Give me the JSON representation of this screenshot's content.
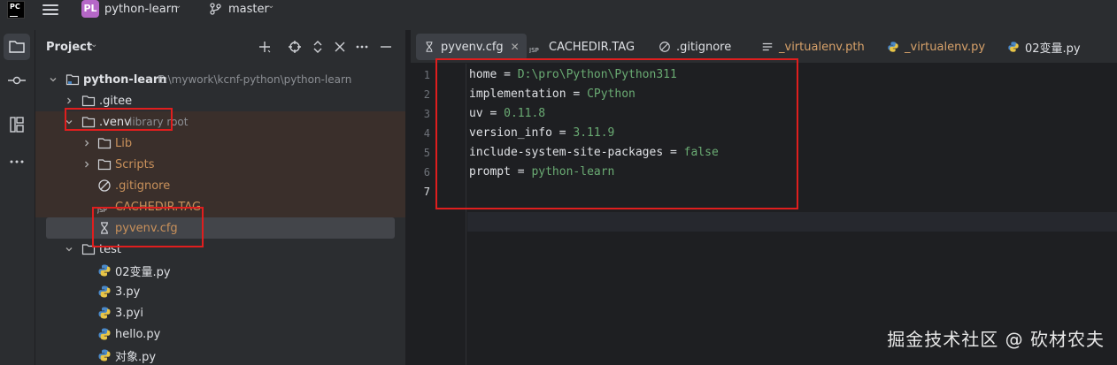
{
  "topbar": {
    "app_logo": "PC",
    "project_badge": "PL",
    "project_name": "python-learn",
    "branch": "master",
    "chevron": "⌄"
  },
  "project_panel": {
    "title": "Project",
    "header_icons": [
      "add-icon",
      "locate-icon",
      "expand-icon",
      "collapse-icon",
      "minimize-icon"
    ]
  },
  "tree": [
    {
      "label": "python-learn",
      "secondary": "E:\\mywork\\kcnf-python\\python-learn",
      "type": "folder",
      "bold": true
    },
    {
      "label": ".gitee",
      "type": "folder"
    },
    {
      "label": ".venv",
      "secondary": "library root",
      "type": "folder"
    },
    {
      "label": "Lib",
      "type": "folder"
    },
    {
      "label": "Scripts",
      "type": "folder"
    },
    {
      "label": ".gitignore",
      "type": "ignore-file"
    },
    {
      "label": "CACHEDIR.TAG",
      "type": "jsp-file"
    },
    {
      "label": "pyvenv.cfg",
      "type": "cfg-file",
      "selected": true
    },
    {
      "label": "test",
      "type": "folder"
    },
    {
      "label": "02变量.py",
      "type": "python-file"
    },
    {
      "label": "3.py",
      "type": "python-file"
    },
    {
      "label": "3.pyi",
      "type": "python-file"
    },
    {
      "label": "hello.py",
      "type": "python-file"
    },
    {
      "label": "对象.py",
      "type": "python-file"
    }
  ],
  "tabs": [
    {
      "label": "pyvenv.cfg",
      "active": true
    },
    {
      "label": "CACHEDIR.TAG"
    },
    {
      "label": ".gitignore"
    },
    {
      "label": "_virtualenv.pth"
    },
    {
      "label": "_virtualenv.py"
    },
    {
      "label": "02变量.py"
    }
  ],
  "tab_close": "✕",
  "code_lines": [
    {
      "n": "1",
      "key": "home = ",
      "val": "D:\\pro\\Python\\Python311"
    },
    {
      "n": "2",
      "key": "implementation = ",
      "val": "CPython"
    },
    {
      "n": "3",
      "key": "uv = ",
      "val": "0.11.8"
    },
    {
      "n": "4",
      "key": "version_info = ",
      "val": "3.11.9"
    },
    {
      "n": "5",
      "key": "include-system-site-packages = ",
      "val": "false"
    },
    {
      "n": "6",
      "key": "prompt = ",
      "val": "python-learn"
    },
    {
      "n": "7",
      "key": "",
      "val": ""
    }
  ],
  "watermark": "掘金技术社区 @ 砍材农夫",
  "colors": {
    "accent_red": "#e01e1e",
    "value_green": "#6aab73",
    "ignored_orange": "#c9915b",
    "project_badge": "#b567c7"
  }
}
